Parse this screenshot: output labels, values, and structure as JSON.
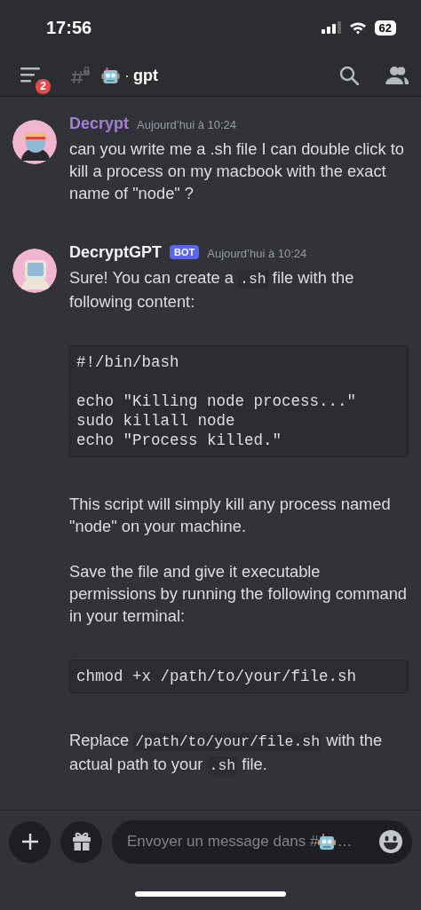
{
  "status_bar": {
    "time": "17:56",
    "battery": "62"
  },
  "header": {
    "unread_badge": "2",
    "separator": "·",
    "channel": "gpt"
  },
  "messages": [
    {
      "author": "Decrypt",
      "color": "#a47fdc",
      "bot": false,
      "time": "Aujourd’hui à 10:24",
      "content": [
        {
          "kind": "text",
          "parts": [
            {
              "kind": "plain",
              "text": "can you write me a .sh file I can double click to kill a process on my macbook with the exact name of \"node\" ?"
            }
          ]
        }
      ]
    },
    {
      "author": "DecryptGPT",
      "color": "#f2f3f5",
      "bot": true,
      "bot_label": "BOT",
      "time": "Aujourd’hui à 10:24",
      "content": [
        {
          "kind": "text",
          "parts": [
            {
              "kind": "plain",
              "text": "Sure! You can create a "
            },
            {
              "kind": "code",
              "text": ".sh"
            },
            {
              "kind": "plain",
              "text": " file with the following content:"
            }
          ]
        },
        {
          "kind": "codeblock",
          "code": "#!/bin/bash\n\necho \"Killing node process...\"\nsudo killall node\necho \"Process killed.\""
        },
        {
          "kind": "text",
          "parts": [
            {
              "kind": "plain",
              "text": "This script will simply kill any process named \"node\" on your machine."
            }
          ]
        },
        {
          "kind": "text",
          "parts": [
            {
              "kind": "plain",
              "text": "Save the file and give it executable permissions by running the following command in your terminal:"
            }
          ]
        },
        {
          "kind": "codeblock",
          "code": "chmod +x /path/to/your/file.sh"
        },
        {
          "kind": "text",
          "parts": [
            {
              "kind": "plain",
              "text": "Replace "
            },
            {
              "kind": "code",
              "text": "/path/to/your/file.sh"
            },
            {
              "kind": "plain",
              "text": " with the actual path to your "
            },
            {
              "kind": "code",
              "text": ".sh"
            },
            {
              "kind": "plain",
              "text": " file."
            }
          ]
        }
      ]
    }
  ],
  "composer": {
    "placeholder": "Envoyer un message dans #",
    "placeholder_end": "…"
  }
}
